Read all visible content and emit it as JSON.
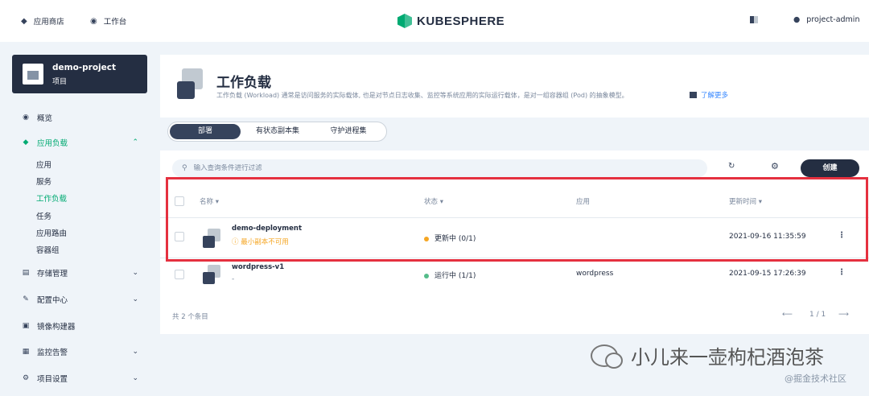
{
  "topbar": {
    "app_store": "应用商店",
    "workbench": "工作台",
    "logo_text": "KUBESPHERE",
    "user": "project-admin"
  },
  "project": {
    "name": "demo-project",
    "type": "项目"
  },
  "sidebar": {
    "overview": "概览",
    "app_workloads": "应用负载",
    "sub_items": [
      "应用",
      "服务",
      "工作负载",
      "任务",
      "应用路由",
      "容器组"
    ],
    "storage": "存储管理",
    "config": "配置中心",
    "image_builder": "镜像构建器",
    "monitoring": "监控告警",
    "settings": "项目设置"
  },
  "page": {
    "title": "工作负载",
    "description": "工作负载 (Workload) 通常是访问服务的实际载体, 也是对节点日志收集、监控等系统应用的实际运行载体，是对一组容器组 (Pod) 的抽象模型。",
    "learn_more": "了解更多"
  },
  "tabs": [
    "部署",
    "有状态副本集",
    "守护进程集"
  ],
  "toolbar": {
    "search_placeholder": "输入查询条件进行过滤",
    "create": "创建"
  },
  "table": {
    "headers": {
      "name": "名称",
      "status": "状态",
      "app": "应用",
      "updated": "更新时间"
    },
    "rows": [
      {
        "name": "demo-deployment",
        "sub": "最小副本不可用",
        "status": "更新中",
        "replicas": "(0/1)",
        "app": "",
        "updated": "2021-09-16 11:35:59"
      },
      {
        "name": "wordpress-v1",
        "sub": "-",
        "status": "运行中",
        "replicas": "(1/1)",
        "app": "wordpress",
        "updated": "2021-09-15 17:26:39"
      }
    ]
  },
  "footer": {
    "total": "共 2 个条目",
    "page": "1 / 1"
  },
  "watermark": {
    "text": "小儿来一壶枸杞酒泡茶",
    "source": "@掘金技术社区"
  },
  "colors": {
    "accent": "#00aa72",
    "dark": "#242e42",
    "warning": "#f5a623",
    "running": "#55bc8a",
    "highlight": "#e5303f"
  }
}
